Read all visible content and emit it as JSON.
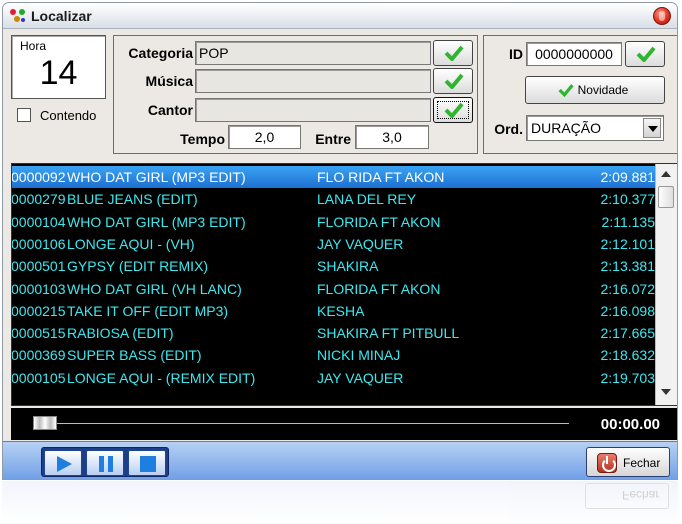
{
  "window": {
    "title": "Localizar"
  },
  "hora": {
    "label": "Hora",
    "value": "14"
  },
  "contendo": {
    "label": "Contendo",
    "checked": false
  },
  "filters": {
    "categoria_label": "Categoria",
    "categoria_value": "POP",
    "musica_label": "Música",
    "musica_value": "",
    "cantor_label": "Cantor",
    "cantor_value": "",
    "tempo_label": "Tempo",
    "tempo_value": "2,0",
    "entre_label": "Entre",
    "entre_value": "3,0"
  },
  "right_panel": {
    "id_label": "ID",
    "id_value": "0000000000",
    "novidade_label": "Novidade",
    "ord_label": "Ord.",
    "ord_value": "DURAÇÃO"
  },
  "tracks": [
    {
      "id": "0000092",
      "title": "WHO DAT GIRL (MP3 EDIT)",
      "artist": "FLO RIDA FT AKON",
      "duration": "2:09.881",
      "selected": true
    },
    {
      "id": "0000279",
      "title": "BLUE JEANS (EDIT)",
      "artist": "LANA DEL REY",
      "duration": "2:10.377",
      "selected": false
    },
    {
      "id": "0000104",
      "title": "WHO DAT GIRL (MP3 EDIT)",
      "artist": "FLORIDA FT AKON",
      "duration": "2:11.135",
      "selected": false
    },
    {
      "id": "0000106",
      "title": "LONGE AQUI - (VH)",
      "artist": "JAY VAQUER",
      "duration": "2:12.101",
      "selected": false
    },
    {
      "id": "0000501",
      "title": "GYPSY (EDIT REMIX)",
      "artist": "SHAKIRA",
      "duration": "2:13.381",
      "selected": false
    },
    {
      "id": "0000103",
      "title": "WHO DAT GIRL  (VH LANC)",
      "artist": "FLORIDA FT AKON",
      "duration": "2:16.072",
      "selected": false
    },
    {
      "id": "0000215",
      "title": "TAKE IT OFF (EDIT MP3)",
      "artist": "KESHA",
      "duration": "2:16.098",
      "selected": false
    },
    {
      "id": "0000515",
      "title": "RABIOSA (EDIT)",
      "artist": "SHAKIRA FT PITBULL",
      "duration": "2:17.665",
      "selected": false
    },
    {
      "id": "0000369",
      "title": "SUPER BASS (EDIT)",
      "artist": "NICKI MINAJ",
      "duration": "2:18.632",
      "selected": false
    },
    {
      "id": "0000105",
      "title": "LONGE AQUI - (REMIX EDIT)",
      "artist": "JAY VAQUER",
      "duration": "2:19.703",
      "selected": false
    }
  ],
  "player": {
    "time": "00:00.00",
    "progress": 0
  },
  "buttons": {
    "fechar_label": "Fechar"
  },
  "icons": {
    "check": "check-icon",
    "play": "play-icon",
    "pause": "pause-icon",
    "stop": "stop-icon",
    "power": "power-icon"
  },
  "colors": {
    "list_text": "#3ee8ef",
    "selection": "#1d6fd1",
    "check_green": "#2fb52f"
  }
}
